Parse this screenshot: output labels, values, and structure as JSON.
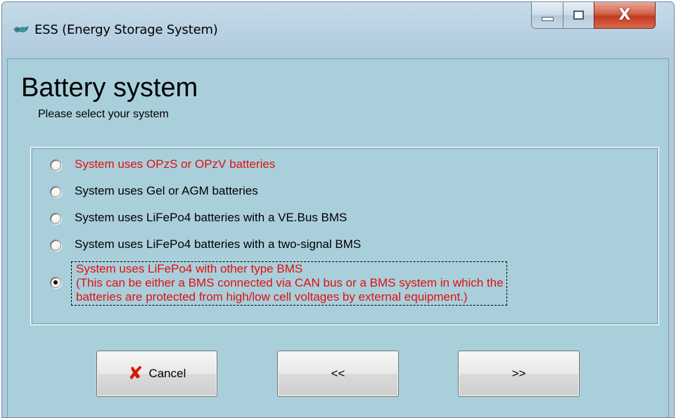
{
  "window": {
    "title": "ESS (Energy Storage System)",
    "icon": "victron-app-icon",
    "controls": {
      "minimize_icon": "minimize-icon",
      "maximize_icon": "maximize-icon",
      "close_glyph": "X"
    }
  },
  "page": {
    "heading": "Battery system",
    "subheading": "Please select your system"
  },
  "options": [
    {
      "label": "System uses OPzS or OPzV batteries",
      "checked": false,
      "color": "#e01010"
    },
    {
      "label": "System uses Gel or AGM batteries",
      "checked": false,
      "color": "#000000"
    },
    {
      "label": "System uses LiFePo4 batteries with a VE.Bus BMS",
      "checked": false,
      "color": "#000000"
    },
    {
      "label": "System uses LiFePo4 batteries with a two-signal BMS",
      "checked": false,
      "color": "#000000"
    },
    {
      "label_lines": [
        "System uses LiFePo4 with other type BMS",
        "(This can be either a BMS connected via CAN bus or a BMS system in which the",
        "batteries are protected from high/low cell voltages by external equipment.)"
      ],
      "checked": true,
      "color": "#e01010"
    }
  ],
  "buttons": {
    "cancel_label": "Cancel",
    "cancel_icon": "red-x-icon",
    "back_label": "<<",
    "next_label": ">>"
  }
}
